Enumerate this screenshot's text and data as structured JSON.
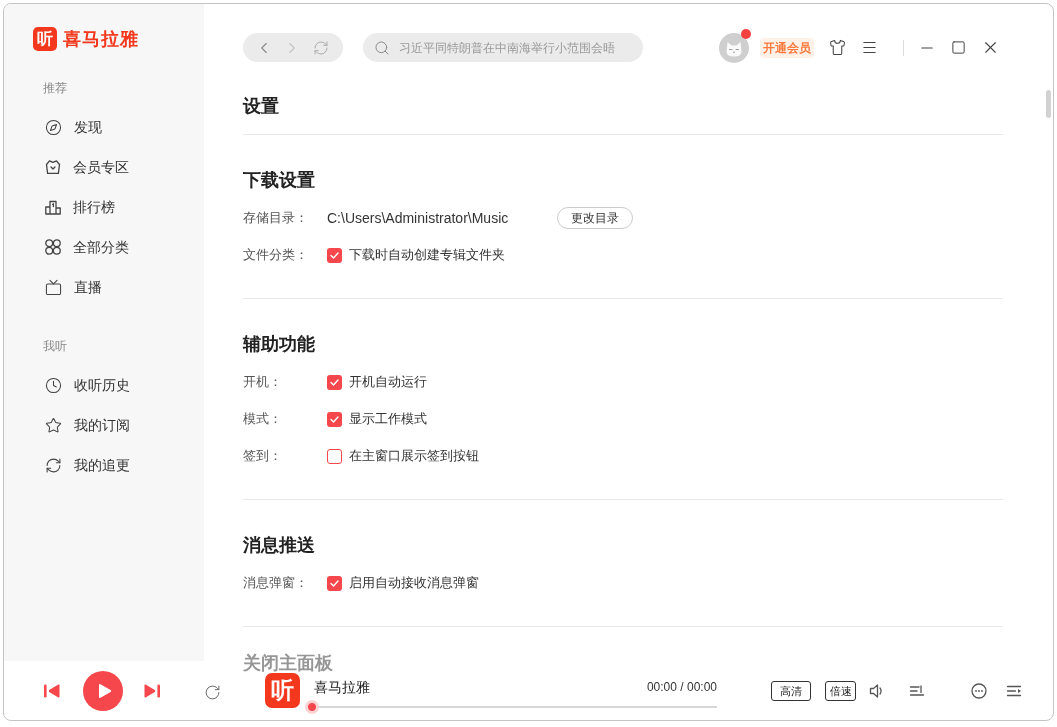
{
  "logo": {
    "mark": "听",
    "text": "喜马拉雅"
  },
  "sidebar": {
    "sections": [
      {
        "label": "推荐",
        "items": [
          {
            "label": "发现",
            "selected": false
          },
          {
            "label": "会员专区",
            "selected": false
          },
          {
            "label": "排行榜",
            "selected": false
          },
          {
            "label": "全部分类",
            "selected": false
          },
          {
            "label": "直播",
            "selected": false
          }
        ]
      },
      {
        "label": "我听",
        "items": [
          {
            "label": "收听历史",
            "selected": false
          },
          {
            "label": "我的订阅",
            "selected": false
          },
          {
            "label": "我的追更",
            "selected": false
          }
        ]
      }
    ]
  },
  "toolbar": {
    "back": {
      "disabled": false
    },
    "forward": {
      "disabled": true
    },
    "search": {
      "placeholder": "习近平同特朗普在中南海举行小范围会晤"
    },
    "avatar": {
      "unread": true
    },
    "vip_button": "开通会员"
  },
  "settings": {
    "title": "设置",
    "sections": [
      {
        "title": "下载设置",
        "dimmed": false,
        "rows": [
          {
            "kind": "path",
            "label": "存储目录：",
            "value": "C:\\Users\\Administrator\\Music",
            "button": "更改目录"
          },
          {
            "kind": "checkbox",
            "label": "文件分类：",
            "text": "下载时自动创建专辑文件夹",
            "checked": true
          }
        ]
      },
      {
        "title": "辅助功能",
        "dimmed": false,
        "rows": [
          {
            "kind": "checkbox",
            "label": "开机：",
            "text": "开机自动运行",
            "checked": true
          },
          {
            "kind": "checkbox",
            "label": "模式：",
            "text": "显示工作模式",
            "checked": true
          },
          {
            "kind": "checkbox",
            "label": "签到：",
            "text": "在主窗口展示签到按钮",
            "checked": false
          }
        ]
      },
      {
        "title": "消息推送",
        "dimmed": false,
        "rows": [
          {
            "kind": "checkbox",
            "label": "消息弹窗：",
            "text": "启用自动接收消息弹窗",
            "checked": true
          }
        ]
      },
      {
        "title": "关闭主面板",
        "dimmed": true
      }
    ]
  },
  "player": {
    "logo_mark": "听",
    "title": "喜马拉雅",
    "time": "00:00 / 00:00",
    "progress": {
      "level": 0
    },
    "quality_button": "高清",
    "speed_button": "倍速"
  }
}
